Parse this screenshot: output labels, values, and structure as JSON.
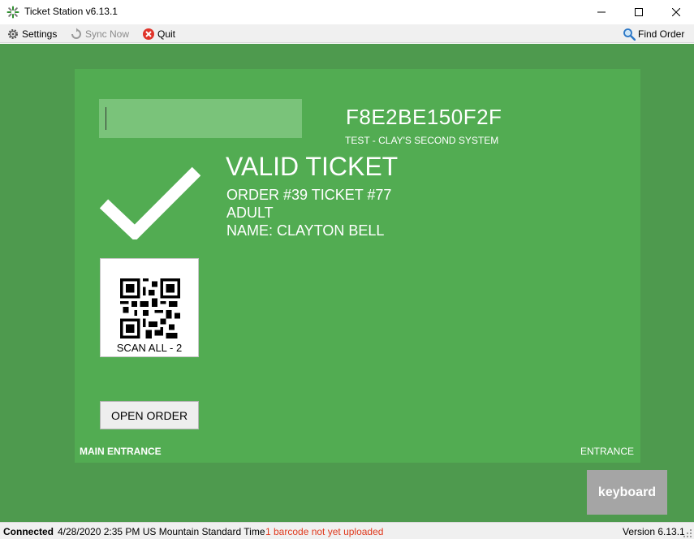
{
  "window": {
    "title": "Ticket Station v6.13.1",
    "controls": {
      "minimize": "—",
      "maximize": "☐",
      "close": "✕"
    }
  },
  "menu": {
    "settings": "Settings",
    "sync": "Sync Now",
    "quit": "Quit",
    "find_order": "Find Order"
  },
  "ticket": {
    "code": "F8E2BE150F2F",
    "system": "TEST - CLAY'S SECOND SYSTEM",
    "status": "VALID TICKET",
    "order_line": "ORDER #39 TICKET #77",
    "type": "ADULT",
    "name_line": "NAME: CLAYTON BELL",
    "scan_input_value": ""
  },
  "actions": {
    "scan_all": "SCAN ALL - 2",
    "open_order": "OPEN ORDER",
    "keyboard": "keyboard"
  },
  "locations": {
    "left": "MAIN ENTRANCE",
    "right": "ENTRANCE"
  },
  "status_bar": {
    "connection": "Connected",
    "datetime": "4/28/2020 2:35 PM US Mountain Standard Time",
    "warning": "1 barcode not yet uploaded",
    "version": "Version 6.13.1"
  },
  "colors": {
    "background": "#4e9a4e",
    "panel": "#52ac52",
    "input": "#7ac37a",
    "warning": "#e03a1e",
    "keyboard_button": "#a5a5a5"
  }
}
